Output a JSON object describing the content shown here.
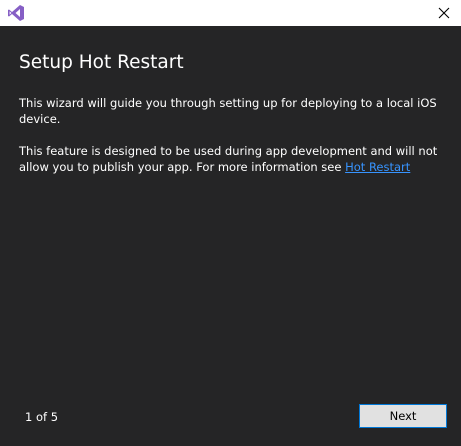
{
  "window": {
    "title": "Setup Hot Restart",
    "icon": "visual-studio-logo-icon",
    "close_icon": "close-icon"
  },
  "content": {
    "para1": "This wizard will guide you through setting up for deploying to a local iOS device.",
    "para2_text": "This feature is designed to be used during app development and will not allow you to publish your app. For more information see ",
    "para2_link": "Hot Restart"
  },
  "footer": {
    "step_counter": "1 of 5",
    "next_label": "Next"
  },
  "colors": {
    "background": "#252526",
    "titlebar": "#ffffff",
    "link": "#3794ff",
    "vs_purple": "#865fc5",
    "button_border": "#0078d7",
    "button_bg": "#e1e1e1"
  }
}
